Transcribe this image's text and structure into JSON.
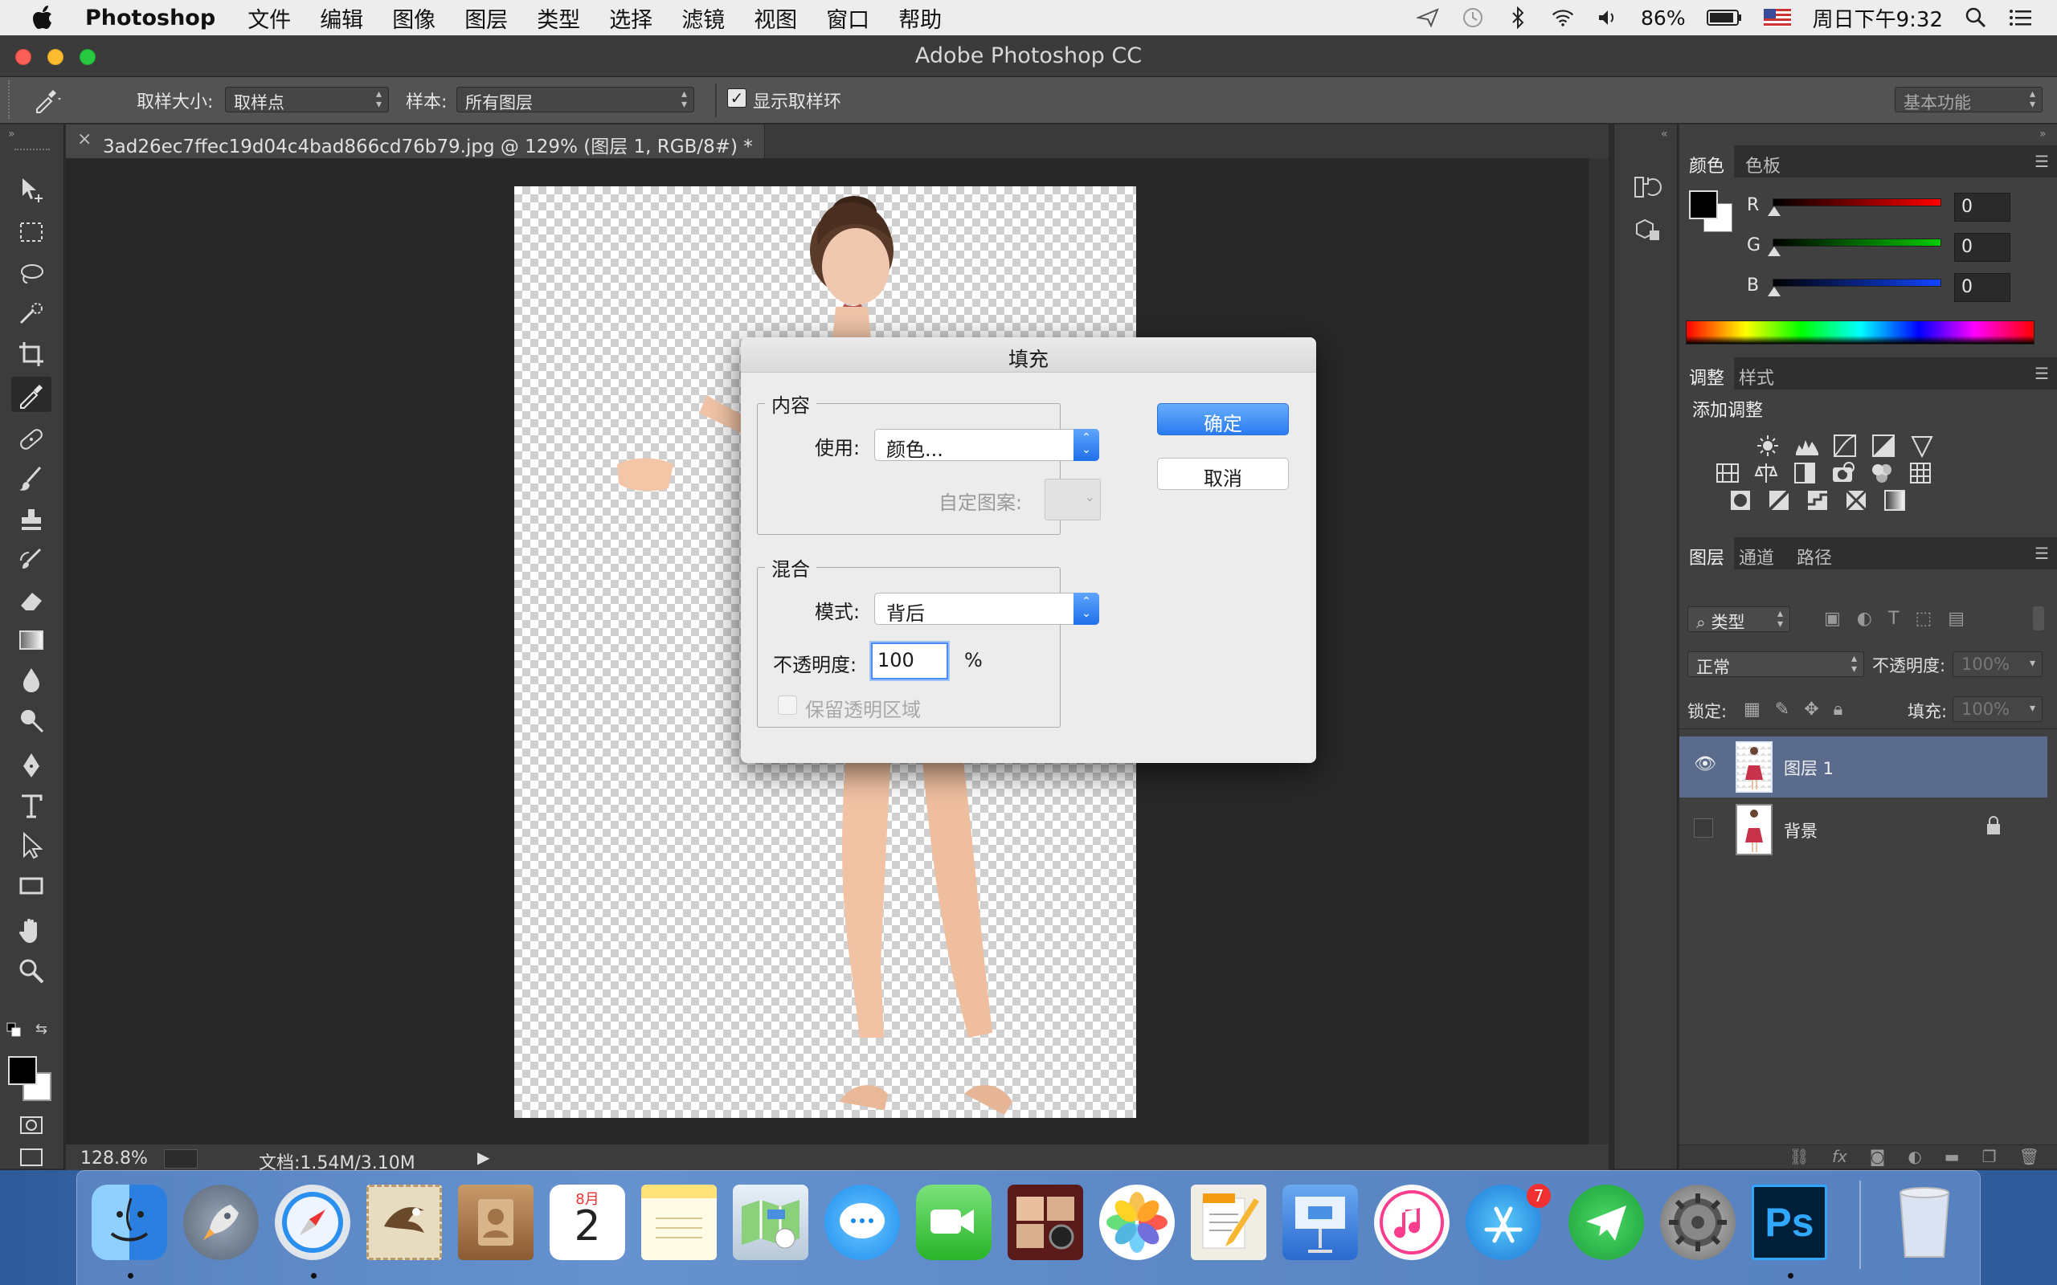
{
  "menubar": {
    "app_name": "Photoshop",
    "items": [
      "文件",
      "编辑",
      "图像",
      "图层",
      "类型",
      "选择",
      "滤镜",
      "视图",
      "窗口",
      "帮助"
    ],
    "battery": "86%",
    "clock": "周日下午9:32"
  },
  "window": {
    "title": "Adobe Photoshop CC"
  },
  "options_bar": {
    "sample_size_label": "取样大小:",
    "sample_size_value": "取样点",
    "sample_label": "样本:",
    "sample_value": "所有图层",
    "show_ring_label": "显示取样环",
    "show_ring_checked": true,
    "workspace": "基本功能"
  },
  "document": {
    "tab_title": "3ad26ec7ffec19d04c4bad866cd76b79.jpg @ 129% (图层 1, RGB/8#) *",
    "zoom": "128.8%",
    "doc_info": "文档:1.54M/3.10M"
  },
  "color_panel": {
    "tabs": [
      "颜色",
      "色板"
    ],
    "channels": [
      {
        "name": "R",
        "value": "0"
      },
      {
        "name": "G",
        "value": "0"
      },
      {
        "name": "B",
        "value": "0"
      }
    ]
  },
  "adjust_panel": {
    "tabs": [
      "调整",
      "样式"
    ],
    "heading": "添加调整"
  },
  "layers_panel": {
    "tabs": [
      "图层",
      "通道",
      "路径"
    ],
    "filter_kind": "类型",
    "blend_mode": "正常",
    "opacity_label": "不透明度:",
    "opacity_value": "100%",
    "lock_label": "锁定:",
    "fill_label": "填充:",
    "fill_value": "100%",
    "layers": [
      {
        "name": "图层 1",
        "visible": true,
        "selected": true,
        "locked": false
      },
      {
        "name": "背景",
        "visible": false,
        "selected": false,
        "locked": true
      }
    ]
  },
  "fill_dialog": {
    "title": "填充",
    "content_group": "内容",
    "use_label": "使用:",
    "use_value": "颜色...",
    "custom_pattern_label": "自定图案:",
    "blend_group": "混合",
    "mode_label": "模式:",
    "mode_value": "背后",
    "opacity_label": "不透明度:",
    "opacity_value": "100",
    "opacity_unit": "%",
    "preserve_label": "保留透明区域",
    "preserve_checked": false,
    "ok": "确定",
    "cancel": "取消"
  },
  "dock": {
    "calendar_month": "8月",
    "calendar_day": "2",
    "appstore_badge": "7",
    "ps_label": "Ps"
  },
  "colors": {
    "accent": "#2a7bf0",
    "dress": "#c8324a",
    "selected_layer": "#5a6b8c"
  }
}
